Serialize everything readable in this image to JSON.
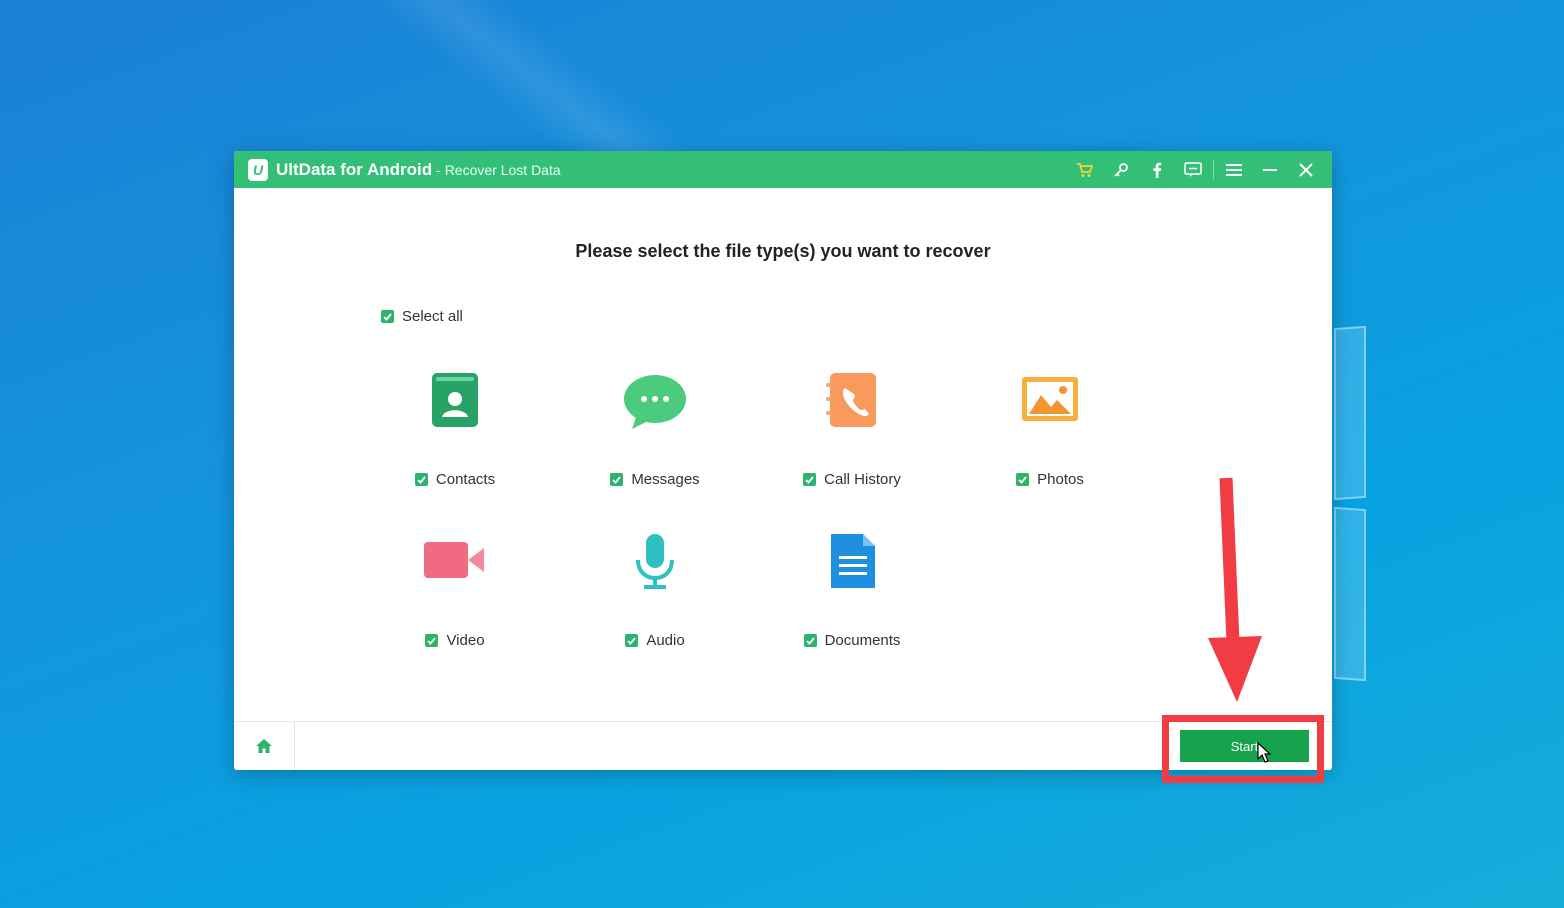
{
  "window": {
    "app_name": "UltData for Android",
    "subtitle": "- Recover Lost Data",
    "logo_letter": "U",
    "titlebar_icons": [
      "cart-icon",
      "key-icon",
      "facebook-icon",
      "feedback-icon",
      "menu-icon",
      "minimize-icon",
      "close-icon"
    ]
  },
  "main": {
    "heading": "Please select the file type(s) you want to recover",
    "select_all": {
      "label": "Select all",
      "checked": true
    },
    "file_types": [
      {
        "label": "Contacts",
        "icon": "contacts-icon",
        "checked": true
      },
      {
        "label": "Messages",
        "icon": "messages-icon",
        "checked": true
      },
      {
        "label": "Call History",
        "icon": "call-history-icon",
        "checked": true
      },
      {
        "label": "Photos",
        "icon": "photos-icon",
        "checked": true
      },
      {
        "label": "Video",
        "icon": "video-icon",
        "checked": true
      },
      {
        "label": "Audio",
        "icon": "audio-icon",
        "checked": true
      },
      {
        "label": "Documents",
        "icon": "documents-icon",
        "checked": true
      }
    ]
  },
  "footer": {
    "home_icon": "home-icon",
    "start_label": "Start"
  },
  "colors": {
    "brand_green": "#34bf76",
    "button_green": "#17a34d",
    "checkbox_green": "#2db36b",
    "annotation_red": "#f03c42"
  }
}
